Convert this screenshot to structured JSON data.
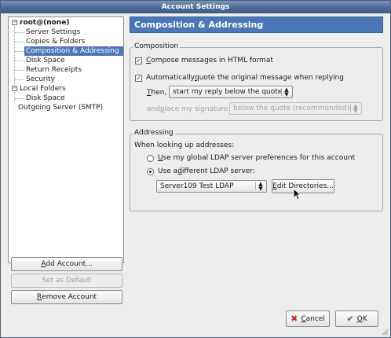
{
  "window": {
    "title": "Account Settings"
  },
  "tree": {
    "items": [
      {
        "label": "root@(none)"
      },
      {
        "label": "Server Settings"
      },
      {
        "label": "Copies & Folders"
      },
      {
        "label": "Composition & Addressing"
      },
      {
        "label": "Disk Space"
      },
      {
        "label": "Return Receipts"
      },
      {
        "label": "Security"
      },
      {
        "label": "Local Folders"
      },
      {
        "label": "Disk Space"
      },
      {
        "label": "Outgoing Server (SMTP)"
      }
    ],
    "selected_index": 3
  },
  "left_buttons": {
    "add_account": {
      "prefix": "",
      "key": "A",
      "rest": "dd Account..."
    },
    "set_default": "Set as Default",
    "remove_account": {
      "prefix": "",
      "key": "R",
      "rest": "emove Account"
    }
  },
  "panel": {
    "header": "Composition & Addressing",
    "composition": {
      "title": "Composition",
      "html_format": {
        "prefix": "",
        "key": "C",
        "rest": "ompose messages in HTML format",
        "checked": true
      },
      "auto_quote": {
        "prefix": "Automatically ",
        "key": "q",
        "rest": "uote the original message when replying",
        "checked": true
      },
      "then_label": {
        "prefix": "",
        "key": "T",
        "rest": "hen,"
      },
      "then_value": "start my reply below the quote",
      "signature_label": {
        "prefix": "and ",
        "key": "p",
        "rest": "lace my signature"
      },
      "signature_value": "below the quote (recommended)"
    },
    "addressing": {
      "title": "Addressing",
      "lookup_label": "When looking up addresses:",
      "global_ldap": {
        "prefix": "",
        "key": "U",
        "rest": "se my global LDAP server preferences for this account",
        "selected": false
      },
      "different_ldap": {
        "prefix": "Use a ",
        "key": "d",
        "rest": "ifferent LDAP server:",
        "selected": true
      },
      "ldap_value": "Server109 Test LDAP",
      "edit_directories": {
        "prefix": "",
        "key": "E",
        "rest": "dit Directories..."
      }
    }
  },
  "footer": {
    "cancel": {
      "prefix": "",
      "key": "C",
      "rest": "ancel"
    },
    "ok": {
      "prefix": "",
      "key": "O",
      "rest": "K"
    }
  },
  "colors": {
    "selection": "#4b76b8",
    "titlebar": "#4f6c98"
  }
}
